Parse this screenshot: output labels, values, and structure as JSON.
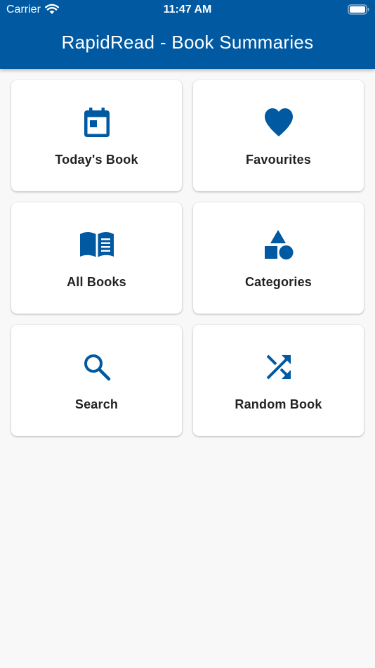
{
  "status_bar": {
    "carrier": "Carrier",
    "time": "11:47 AM",
    "wifi_icon": "wifi-icon",
    "battery_icon": "battery-icon"
  },
  "app_bar": {
    "title": "RapidRead - Book Summaries",
    "background_color": "#0059a1"
  },
  "menu": {
    "accent_color": "#0059a1",
    "items": [
      {
        "label": "Today's Book",
        "icon": "calendar-icon"
      },
      {
        "label": "Favourites",
        "icon": "heart-icon"
      },
      {
        "label": "All Books",
        "icon": "open-book-icon"
      },
      {
        "label": "Categories",
        "icon": "shapes-icon"
      },
      {
        "label": "Search",
        "icon": "search-icon"
      },
      {
        "label": "Random Book",
        "icon": "shuffle-icon"
      }
    ]
  }
}
